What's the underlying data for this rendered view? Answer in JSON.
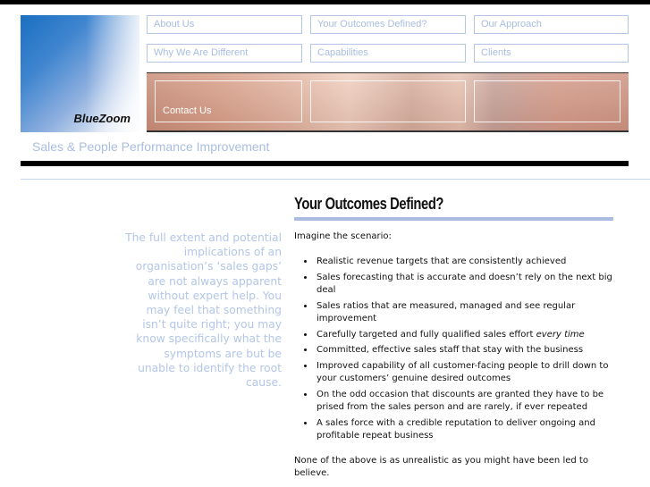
{
  "brand": {
    "name": "BlueZoom",
    "tagline": "Sales & People Performance Improvement"
  },
  "nav": {
    "row1": [
      "About Us",
      "Your Outcomes Defined?",
      "Our Approach"
    ],
    "row2": [
      "Why We Are Different",
      "Capabilities",
      "Clients"
    ],
    "photo_links": [
      "Contact Us",
      "",
      ""
    ]
  },
  "sidebar": {
    "quote": "The full extent and potential implications of an organisation’s ‘sales gaps’ are not always apparent without expert help. You may feel that something isn’t quite right; you may know specifically what the symptoms are but be unable to identify the root cause."
  },
  "main": {
    "title": "Your Outcomes Defined?",
    "intro": "Imagine the scenario:",
    "bullets": [
      "Realistic revenue targets that are consistently achieved",
      "Sales forecasting that is accurate and doesn’t rely on the next big deal",
      "Sales ratios that are measured, managed and see regular improvement",
      "Carefully targeted and fully qualified sales effort ",
      "Committed, effective sales staff that stay with the business",
      "Improved capability of all customer-facing people to drill down to your customers’ genuine desired outcomes",
      "On the odd occasion that discounts are granted they have to be prised from the sales person and are rarely, if ever repeated",
      "A sales force with a credible reputation to deliver ongoing and profitable repeat business"
    ],
    "bullet4_emphasis": "every time",
    "outro": "None of the above is as unrealistic as you might have been led to believe."
  },
  "colors": {
    "accent": "#aabde0",
    "nav_text": "#a9bde0",
    "logo_blue": "#1a6fc2"
  }
}
